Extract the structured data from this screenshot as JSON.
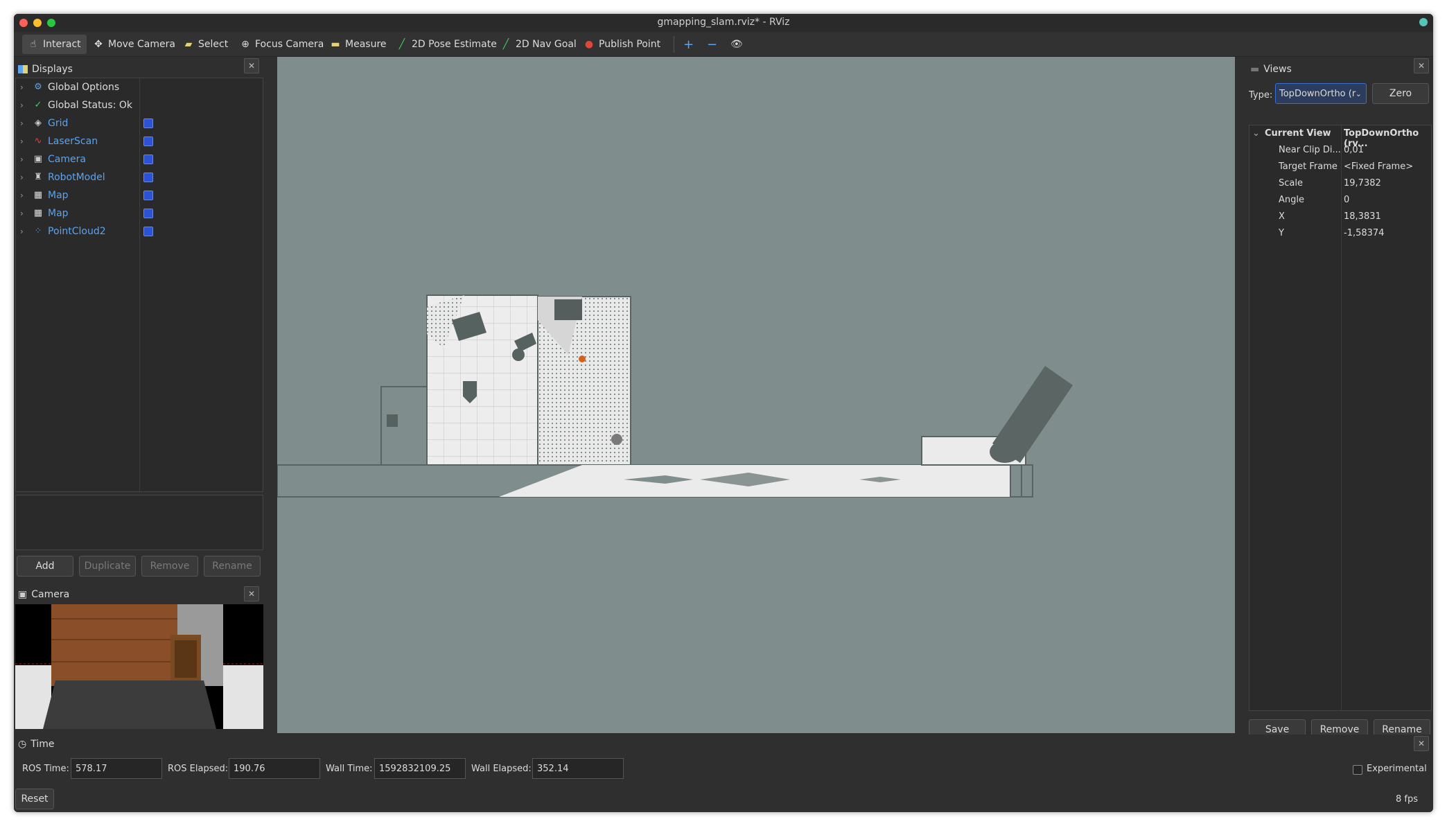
{
  "window": {
    "title": "gmapping_slam.rviz* - RViz"
  },
  "toolbar": {
    "interact": "Interact",
    "move_camera": "Move Camera",
    "select": "Select",
    "focus_camera": "Focus Camera",
    "measure": "Measure",
    "pose_estimate": "2D Pose Estimate",
    "nav_goal": "2D Nav Goal",
    "publish_point": "Publish Point"
  },
  "displays": {
    "title": "Displays",
    "items": [
      {
        "label": "Global Options",
        "icon": "gear-icon"
      },
      {
        "label": "Global Status: Ok",
        "icon": "check-icon"
      },
      {
        "label": "Grid",
        "icon": "grid-icon"
      },
      {
        "label": "LaserScan",
        "icon": "laserscan-icon"
      },
      {
        "label": "Camera",
        "icon": "camera-icon"
      },
      {
        "label": "RobotModel",
        "icon": "robot-icon"
      },
      {
        "label": "Map",
        "icon": "map-icon"
      },
      {
        "label": "Map",
        "icon": "map-icon"
      },
      {
        "label": "PointCloud2",
        "icon": "pointcloud-icon"
      }
    ],
    "buttons": {
      "add": "Add",
      "duplicate": "Duplicate",
      "remove": "Remove",
      "rename": "Rename"
    }
  },
  "camera_panel": {
    "title": "Camera"
  },
  "views": {
    "title": "Views",
    "type_label": "Type:",
    "type_value": "TopDownOrtho (r",
    "zero": "Zero",
    "current_view": {
      "key": "Current View",
      "value": "TopDownOrtho (rv..."
    },
    "props": [
      {
        "key": "Near Clip Di...",
        "value": "0,01"
      },
      {
        "key": "Target Frame",
        "value": "<Fixed Frame>"
      },
      {
        "key": "Scale",
        "value": "19,7382"
      },
      {
        "key": "Angle",
        "value": "0"
      },
      {
        "key": "X",
        "value": "18,3831"
      },
      {
        "key": "Y",
        "value": "-1,58374"
      }
    ],
    "buttons": {
      "save": "Save",
      "remove": "Remove",
      "rename": "Rename"
    }
  },
  "time": {
    "title": "Time",
    "ros_time_label": "ROS Time:",
    "ros_time": "578.17",
    "ros_elapsed_label": "ROS Elapsed:",
    "ros_elapsed": "190.76",
    "wall_time_label": "Wall Time:",
    "wall_time": "1592832109.25",
    "wall_elapsed_label": "Wall Elapsed:",
    "wall_elapsed": "352.14",
    "experimental": "Experimental",
    "reset": "Reset",
    "fps": "8 fps"
  },
  "colors": {
    "viewport_bg": "#7f8e8c",
    "accent_blue": "#5aa4f0",
    "checkbox_blue": "#2c52d6"
  }
}
